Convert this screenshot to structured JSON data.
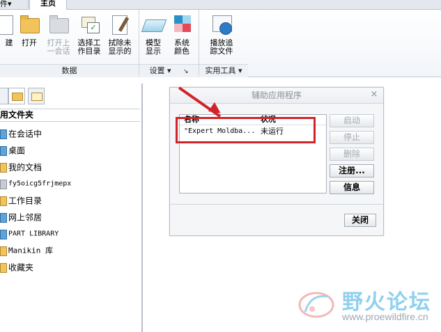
{
  "ribbon": {
    "tabs": {
      "file": "件▾",
      "home": "主页"
    },
    "buttons": [
      {
        "label": "建",
        "enabled": true
      },
      {
        "label": "打开",
        "enabled": true
      },
      {
        "label_line1": "打开上",
        "label_line2": "一会话",
        "enabled": false
      },
      {
        "label_line1": "选择工",
        "label_line2": "作目录",
        "enabled": true
      },
      {
        "label_line1": "拭除未",
        "label_line2": "显示的",
        "enabled": true
      },
      {
        "label_line1": "模型",
        "label_line2": "显示",
        "enabled": true
      },
      {
        "label_line1": "系统",
        "label_line2": "颜色",
        "enabled": true
      },
      {
        "label_line1": "播放追",
        "label_line2": "踪文件",
        "enabled": true
      }
    ],
    "groups": {
      "data": "数据",
      "settings": "设置 ▾",
      "settings_launcher": "↘",
      "utilities": "实用工具 ▾"
    }
  },
  "folder_panel": {
    "header": "用文件夹",
    "items": [
      {
        "label": "在会话中",
        "icon": "session-icon"
      },
      {
        "label": "桌面",
        "icon": "desktop-icon"
      },
      {
        "label": "我的文档",
        "icon": "documents-folder-icon"
      },
      {
        "label": "fy5oicg5frjmepx",
        "icon": "computer-icon"
      },
      {
        "label": "工作目录",
        "icon": "working-dir-icon"
      },
      {
        "label": "网上邻居",
        "icon": "network-icon"
      },
      {
        "label": "PART LIBRARY",
        "icon": "library-icon"
      },
      {
        "label": "Manikin 库",
        "icon": "folder-icon"
      },
      {
        "label": "收藏夹",
        "icon": "favorites-folder-icon"
      }
    ]
  },
  "dialog": {
    "title": "辅助应用程序",
    "close_glyph": "×",
    "columns": {
      "name": "名称",
      "status": "状况"
    },
    "rows": [
      {
        "name": "\"Expert Moldba...",
        "status": "未运行"
      }
    ],
    "buttons": {
      "start": "启动",
      "stop": "停止",
      "delete": "删除",
      "register": "注册...",
      "info": "信息",
      "close": "关闭"
    }
  },
  "watermark": {
    "title": "野火论坛",
    "url": "www.proewildfire.cn"
  },
  "colors": {
    "annotation_red": "#d2232a",
    "watermark_blue": "#8fd0ee"
  }
}
